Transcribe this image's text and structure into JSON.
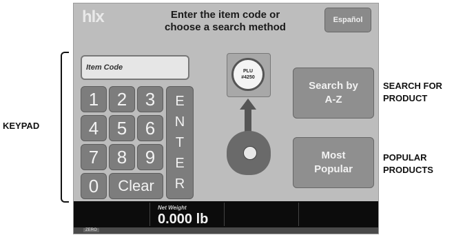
{
  "annotations": {
    "keypad": "KEYPAD",
    "search_line1": "SEARCH FOR",
    "search_line2": "PRODUCT",
    "popular_line1": "POPULAR",
    "popular_line2": "PRODUCTS"
  },
  "header": {
    "logo": "hlx",
    "title_line1": "Enter the item code or",
    "title_line2": "choose a search method",
    "language_button": "Español"
  },
  "item_code": {
    "placeholder": "Item Code"
  },
  "keypad": {
    "keys": [
      "1",
      "2",
      "3",
      "4",
      "5",
      "6",
      "7",
      "8",
      "9",
      "0",
      "Clear"
    ],
    "enter_letters": [
      "E",
      "N",
      "T",
      "E",
      "R"
    ]
  },
  "plu": {
    "line1": "PLU",
    "line2": "#4250"
  },
  "buttons": {
    "search_az_line1": "Search by",
    "search_az_line2": "A-Z",
    "popular_line1": "Most",
    "popular_line2": "Popular"
  },
  "status": {
    "net_weight_label": "Net Weight",
    "net_weight_value": "0.000 lb",
    "footer_tag": "ZERO"
  },
  "colors": {
    "screen_bg": "#bdbdbd",
    "key_bg": "#7d7d7d",
    "status_bg": "#0c0c0c"
  }
}
